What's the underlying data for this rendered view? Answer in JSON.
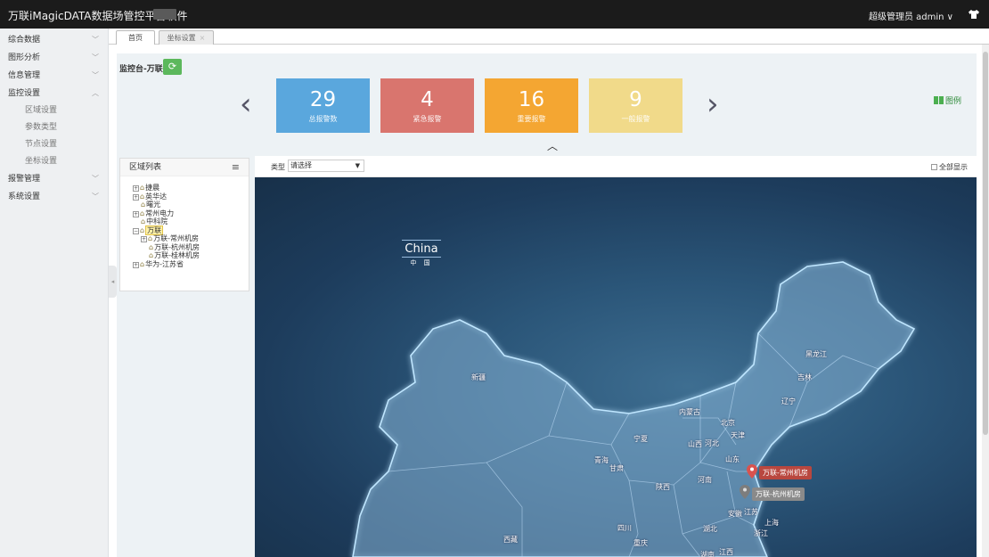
{
  "header": {
    "app_title": "万联iMagicDATA数据场管控平台软件",
    "user_role": "超级管理员",
    "username": "admin"
  },
  "sidebar": {
    "items": [
      {
        "label": "综合数据",
        "expanded": false
      },
      {
        "label": "图形分析",
        "expanded": false
      },
      {
        "label": "信息管理",
        "expanded": false
      },
      {
        "label": "监控设置",
        "expanded": true
      },
      {
        "label": "报警管理",
        "expanded": false
      },
      {
        "label": "系统设置",
        "expanded": false
      }
    ],
    "monitor_sub": [
      "区域设置",
      "参数类型",
      "节点设置",
      "坐标设置"
    ]
  },
  "tabs": [
    {
      "label": "首页",
      "active": true
    },
    {
      "label": "坐标设置",
      "active": false
    }
  ],
  "console": {
    "label": "监控台-万联",
    "refresh_icon": "refresh-icon"
  },
  "stats": [
    {
      "value": "29",
      "label": "总报警数",
      "color": "#5aa7dd"
    },
    {
      "value": "4",
      "label": "紧急报警",
      "color": "#d9756e"
    },
    {
      "value": "16",
      "label": "重要报警",
      "color": "#f4a632"
    },
    {
      "value": "9",
      "label": "一般报警",
      "color": "#f1da8a"
    }
  ],
  "legend_label": "图例",
  "region": {
    "title": "区域列表",
    "tree": [
      {
        "label": "捷晨",
        "level": 0,
        "expandable": true
      },
      {
        "label": "英华达",
        "level": 0,
        "expandable": true
      },
      {
        "label": "曙光",
        "level": 0,
        "expandable": false
      },
      {
        "label": "常州电力",
        "level": 0,
        "expandable": true
      },
      {
        "label": "中科院",
        "level": 0,
        "expandable": false
      },
      {
        "label": "万联",
        "level": 0,
        "expandable": true,
        "selected": true
      },
      {
        "label": "万联-常州机房",
        "level": 1,
        "expandable": true
      },
      {
        "label": "万联-杭州机房",
        "level": 1,
        "expandable": false
      },
      {
        "label": "万联-桂林机房",
        "level": 1,
        "expandable": false
      },
      {
        "label": "华为-江苏省",
        "level": 0,
        "expandable": true
      }
    ]
  },
  "map_toolbar": {
    "type_label": "类型",
    "type_value": "请选择",
    "show_all": "全部显示"
  },
  "map": {
    "title_en": "China",
    "title_zh": "中 国",
    "provinces": [
      "新疆",
      "内蒙古",
      "黑龙江",
      "吉林",
      "辽宁",
      "北京",
      "天津",
      "河北",
      "山西",
      "宁夏",
      "青海",
      "甘肃",
      "陕西",
      "山东",
      "河南",
      "安徽",
      "江苏",
      "上海",
      "浙江",
      "湖北",
      "四川",
      "重庆",
      "西藏",
      "江西",
      "湖南"
    ],
    "markers": [
      {
        "label": "万联-常州机房",
        "color": "#d9534f"
      },
      {
        "label": "万联-杭州机房",
        "color": "#8a8a8a"
      }
    ]
  }
}
